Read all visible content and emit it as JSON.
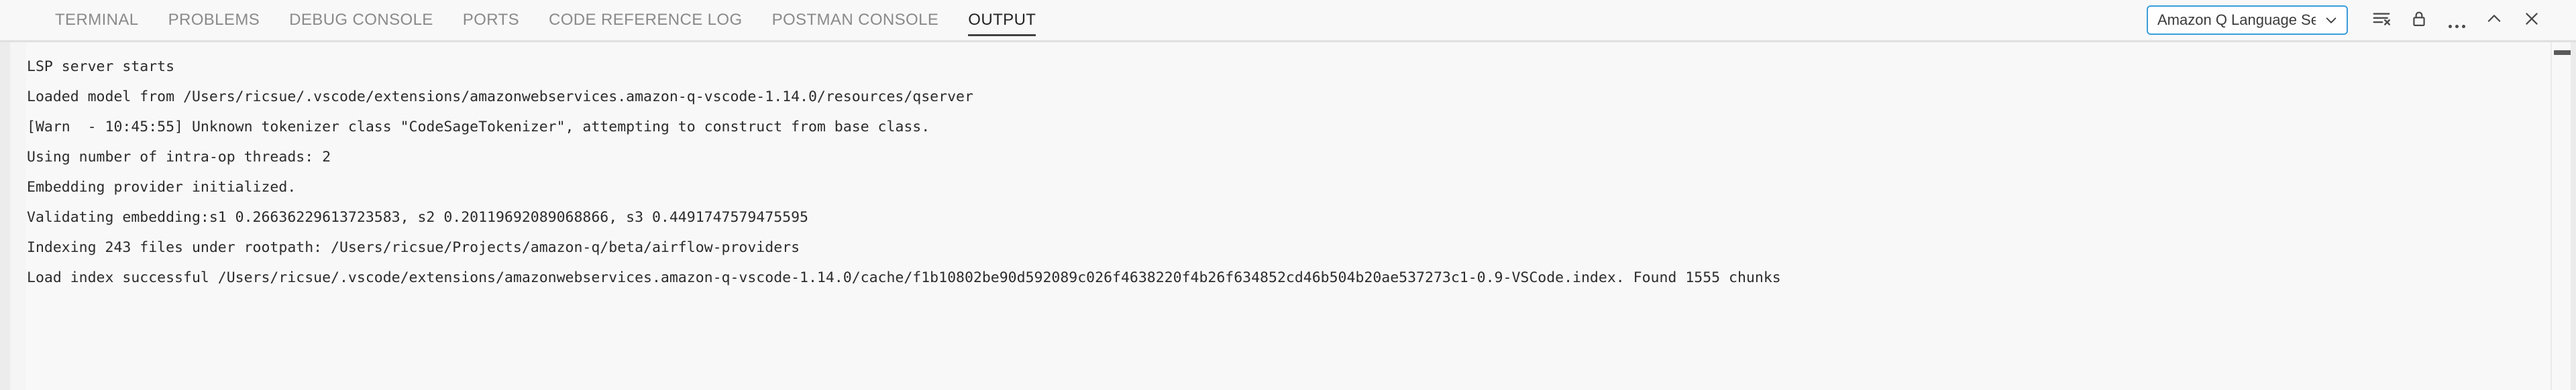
{
  "panel": {
    "tabs": [
      {
        "label": "TERMINAL",
        "active": false
      },
      {
        "label": "PROBLEMS",
        "active": false
      },
      {
        "label": "DEBUG CONSOLE",
        "active": false
      },
      {
        "label": "PORTS",
        "active": false
      },
      {
        "label": "CODE REFERENCE LOG",
        "active": false
      },
      {
        "label": "POSTMAN CONSOLE",
        "active": false
      },
      {
        "label": "OUTPUT",
        "active": true
      }
    ],
    "actions": {
      "channel_select": {
        "value": "Amazon Q Language Serv",
        "icon": "chevron-down-icon"
      },
      "clear_output": {
        "label": "Clear Output",
        "icon": "clear-output-icon"
      },
      "lock_scroll": {
        "label": "Turn Auto Scrolling Off",
        "icon": "lock-icon"
      },
      "more_actions": {
        "label": "Views and More Actions...",
        "icon": "ellipsis-icon"
      },
      "maximize": {
        "label": "Maximize Panel Size",
        "icon": "chevron-up-icon"
      },
      "close": {
        "label": "Close Panel",
        "icon": "close-icon"
      }
    }
  },
  "output": {
    "lines": [
      "LSP server starts",
      "Loaded model from /Users/ricsue/.vscode/extensions/amazonwebservices.amazon-q-vscode-1.14.0/resources/qserver",
      "[Warn  - 10:45:55] Unknown tokenizer class \"CodeSageTokenizer\", attempting to construct from base class.",
      "Using number of intra-op threads: 2",
      "Embedding provider initialized.",
      "Validating embedding:s1 0.26636229613723583, s2 0.20119692089068866, s3 0.4491747579475595",
      "Indexing 243 files under rootpath: /Users/ricsue/Projects/amazon-q/beta/airflow-providers",
      "Load index successful /Users/ricsue/.vscode/extensions/amazonwebservices.amazon-q-vscode-1.14.0/cache/f1b10802be90d592089c026f4638220f4b26f634852cd46b504b20ae537273c1-0.9-VSCode.index. Found 1555 chunks"
    ]
  },
  "colors": {
    "panel_bg": "#f8f8f8",
    "text": "#2b2b2b",
    "tab_inactive": "#8a8a8a",
    "tab_active": "#232323",
    "focus_border": "#3b9dd9",
    "divider": "#e0e0e0"
  }
}
